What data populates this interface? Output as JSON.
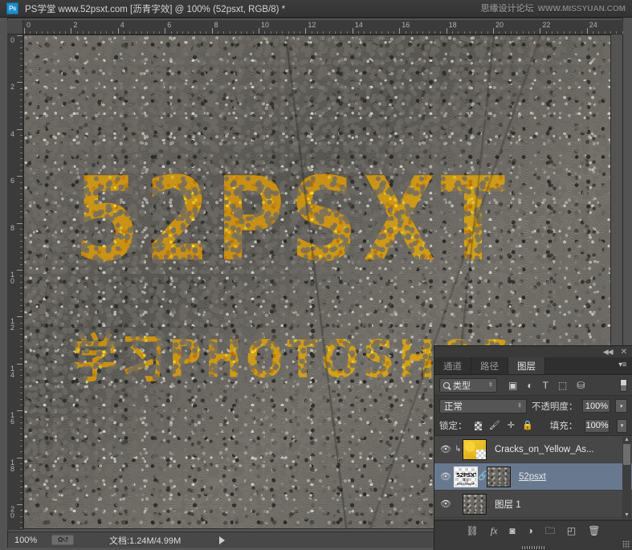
{
  "titlebar": {
    "logo": "Ps",
    "title": "PS学堂 www.52psxt.com [沥青字效] @ 100% (52psxt, RGB/8) *",
    "watermark_cn": "思缘设计论坛",
    "watermark_url": "WWW.MISSYUAN.COM"
  },
  "rulers": {
    "unit_max_h": 24,
    "unit_max_v": 20,
    "h_labels": [
      "0",
      "2",
      "4",
      "6",
      "8",
      "10",
      "12",
      "14",
      "16",
      "18",
      "20",
      "22",
      "24"
    ],
    "v_labels": [
      "0",
      "2",
      "4",
      "6",
      "8",
      "10",
      "12",
      "14",
      "16",
      "18",
      "20"
    ]
  },
  "canvas": {
    "paint_line1": "52PSXT",
    "paint_line2": "学习PHOTOSHOP",
    "paint_color": "#d9ad1b",
    "asphalt_color": "#6f6c68"
  },
  "statusbar": {
    "zoom": "100%",
    "icon": "preview-toggle-icon",
    "doc_info": "文档:1.24M/4.99M",
    "arrow": "▶"
  },
  "panel": {
    "collapse_icon": "◀◀",
    "close_icon": "✕",
    "menu_icon": "▾≡",
    "tabs": [
      {
        "label": "通道",
        "active": false
      },
      {
        "label": "路径",
        "active": false
      },
      {
        "label": "图层",
        "active": true
      }
    ],
    "filter": {
      "search_icon": "search-icon",
      "type_label": "类型",
      "spinner": "⇳",
      "icons": [
        "pixel-layer-filter-icon",
        "adjustment-layer-filter-icon",
        "type-layer-filter-icon",
        "shape-layer-filter-icon",
        "smart-object-filter-icon"
      ],
      "icon_glyphs": [
        "▣",
        "◐",
        "T",
        "⬚",
        "⛁"
      ],
      "toggle": "filter-enable-toggle"
    },
    "mode": {
      "blend_mode": "正常",
      "blend_arrow": "⇳",
      "opacity_label": "不透明度：",
      "opacity_value": "100%",
      "opacity_arrow": "▾"
    },
    "lock": {
      "lock_label": "锁定：",
      "icons": [
        "lock-transparent-pixels-icon",
        "lock-image-pixels-icon",
        "lock-position-icon",
        "lock-all-icon"
      ],
      "icon_glyphs": [
        "▨",
        "🖌",
        "✛",
        "🔒"
      ],
      "fill_label": "填充：",
      "fill_value": "100%",
      "fill_arrow": "▾"
    },
    "layers": [
      {
        "name": "Cracks_on_Yellow_As...",
        "visible": true,
        "eye": "👁",
        "clipped": true,
        "clip_glyph": "↳",
        "selected": false,
        "thumb": "yellow-cracks-thumbnail",
        "has_mask": false,
        "underline": false
      },
      {
        "name": "52psxt",
        "visible": true,
        "eye": "👁",
        "clipped": false,
        "selected": true,
        "thumb": "text-layer-thumbnail",
        "thumb_text": "52PSXT",
        "thumb_text2": "学习PHOTOSHOP",
        "has_mask": true,
        "link_glyph": "🔗",
        "mask_thumb": "asphalt-mask-thumbnail",
        "underline": true
      },
      {
        "name": "图层 1",
        "visible": true,
        "eye": "👁",
        "clipped": false,
        "selected": false,
        "thumb": "asphalt-background-thumbnail",
        "has_mask": false,
        "underline": false
      }
    ],
    "scrollbar": {
      "up": "▲",
      "down": "▼"
    },
    "bottom_tools": [
      {
        "name": "link-layers-button",
        "glyph": "⛓"
      },
      {
        "name": "layer-styles-button",
        "glyph": "fx"
      },
      {
        "name": "add-layer-mask-button",
        "glyph": "◙"
      },
      {
        "name": "new-adjustment-layer-button",
        "glyph": "◑"
      },
      {
        "name": "new-group-button",
        "glyph": "🗀"
      },
      {
        "name": "new-layer-button",
        "glyph": "◰"
      },
      {
        "name": "delete-layer-button",
        "glyph": "🗑"
      }
    ]
  }
}
